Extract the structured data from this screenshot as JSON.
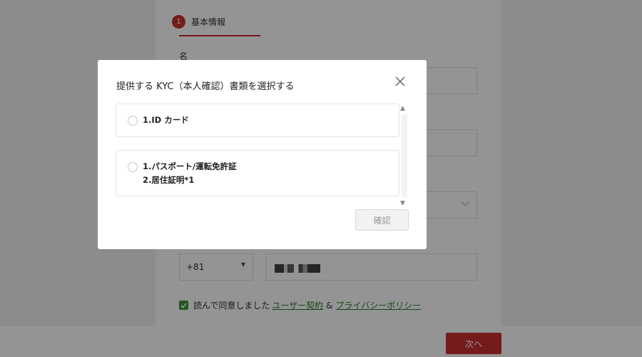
{
  "step": {
    "number": "1",
    "label": "基本情報"
  },
  "form": {
    "first_field_label": "名",
    "phone_code": "+81"
  },
  "agreement": {
    "prefix": "読んで同意しました",
    "terms_link": "ユーザー契約",
    "amp": "&",
    "privacy_link": "プライバシーポリシー"
  },
  "footer": {
    "next_label": "次へ"
  },
  "modal": {
    "title": "提供する KYC（本人確認）書類を選択する",
    "options": [
      {
        "line1": "1.ID カード",
        "line2": ""
      },
      {
        "line1": "1.パスポート/運転免許証",
        "line2": "2.居住証明*1"
      }
    ],
    "confirm_label": "確認"
  },
  "colors": {
    "brand": "#c8302f",
    "check": "#3e9a37",
    "link": "#2e7d2a"
  },
  "icons": {
    "close": "close-icon",
    "checkbox": "check-icon",
    "dropdown": "chevron-down-icon"
  }
}
